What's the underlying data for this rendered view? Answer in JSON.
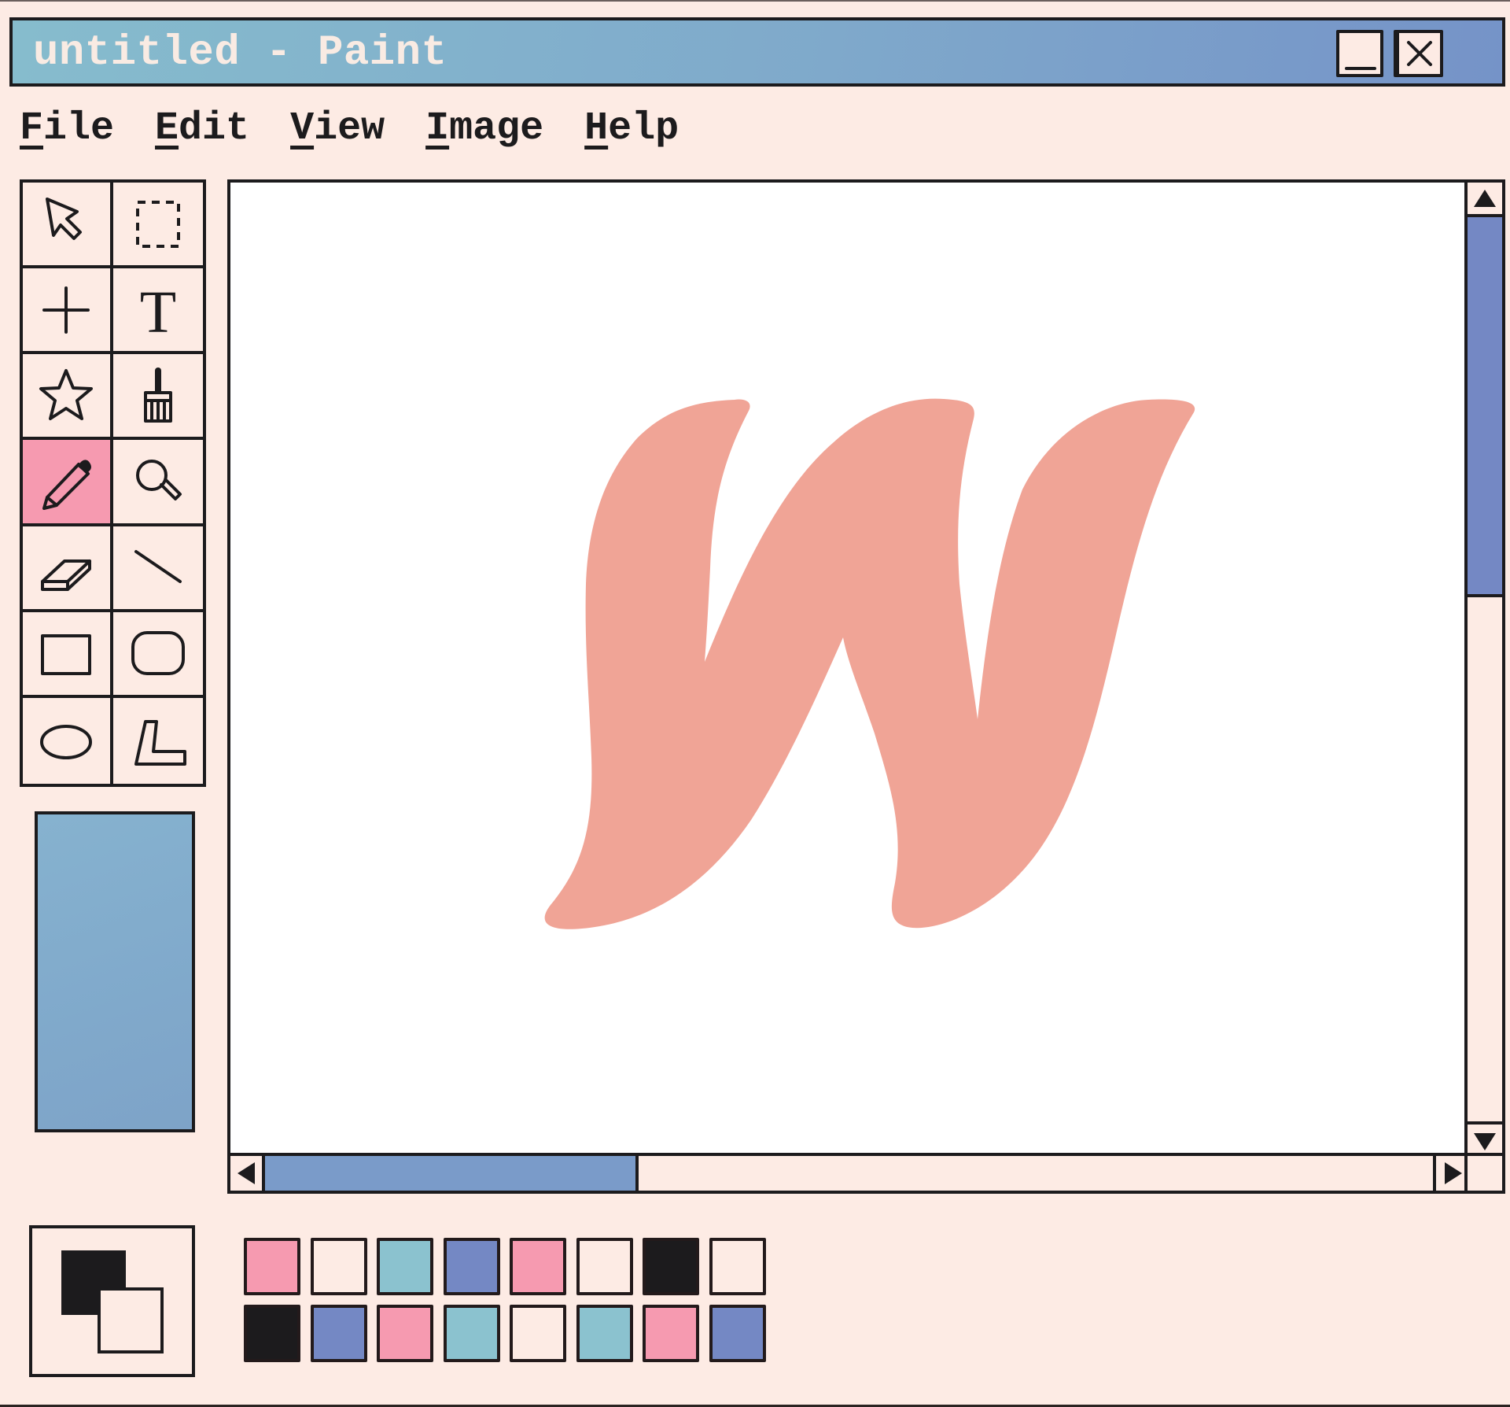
{
  "window": {
    "title": "untitled - Paint",
    "controls": [
      {
        "name": "minimize-button",
        "icon": "minimize-icon"
      },
      {
        "name": "maximize-button",
        "icon": "maximize-icon"
      },
      {
        "name": "close-button",
        "icon": "close-icon"
      }
    ]
  },
  "menu": [
    {
      "label": "File",
      "mnemonic": "F",
      "rest": "ile"
    },
    {
      "label": "Edit",
      "mnemonic": "E",
      "rest": "dit"
    },
    {
      "label": "View",
      "mnemonic": "V",
      "rest": "iew"
    },
    {
      "label": "Image",
      "mnemonic": "I",
      "rest": "mage"
    },
    {
      "label": "Help",
      "mnemonic": "H",
      "rest": "elp"
    }
  ],
  "tools": [
    {
      "id": "select",
      "icon": "arrow-cursor-icon",
      "active": false
    },
    {
      "id": "rect-select",
      "icon": "dashed-selection-icon",
      "active": false
    },
    {
      "id": "crosshair",
      "icon": "crosshair-icon",
      "active": false
    },
    {
      "id": "text",
      "icon": "text-icon",
      "active": false
    },
    {
      "id": "star",
      "icon": "star-icon",
      "active": false
    },
    {
      "id": "brush",
      "icon": "brush-icon",
      "active": false
    },
    {
      "id": "pencil",
      "icon": "pencil-icon",
      "active": true
    },
    {
      "id": "magnifier",
      "icon": "magnifier-icon",
      "active": false
    },
    {
      "id": "eraser",
      "icon": "eraser-icon",
      "active": false
    },
    {
      "id": "line",
      "icon": "line-icon",
      "active": false
    },
    {
      "id": "rectangle",
      "icon": "rectangle-icon",
      "active": false
    },
    {
      "id": "rounded-rectangle",
      "icon": "rounded-rectangle-icon",
      "active": false
    },
    {
      "id": "ellipse",
      "icon": "ellipse-icon",
      "active": false
    },
    {
      "id": "polygon",
      "icon": "polygon-icon",
      "active": false
    }
  ],
  "colors": {
    "accent_pink": "#f69ab0",
    "cream": "#fdebe4",
    "teal": "#8bc2cf",
    "blue": "#7488c4",
    "black": "#1c1b1d",
    "drawing": "#f0a496",
    "side_panel": "#80a9cb"
  },
  "current_colors": {
    "foreground": "#1c1b1d",
    "background": "#fdebe4"
  },
  "palette": [
    "#f69ab0",
    "#fdebe4",
    "#8bc2cf",
    "#7488c4",
    "#f69ab0",
    "#fdebe4",
    "#1c1b1d",
    "#fdebe4",
    "#1c1b1d",
    "#7488c4",
    "#f69ab0",
    "#8bc2cf",
    "#fdebe4",
    "#8bc2cf",
    "#f69ab0",
    "#7488c4"
  ],
  "scroll": {
    "vertical": {
      "position": 0.0,
      "visible_fraction": 0.42
    },
    "horizontal": {
      "position": 0.0,
      "visible_fraction": 0.32
    }
  },
  "canvas": {
    "drawing": "letter-w",
    "drawing_color": "#f0a496"
  }
}
